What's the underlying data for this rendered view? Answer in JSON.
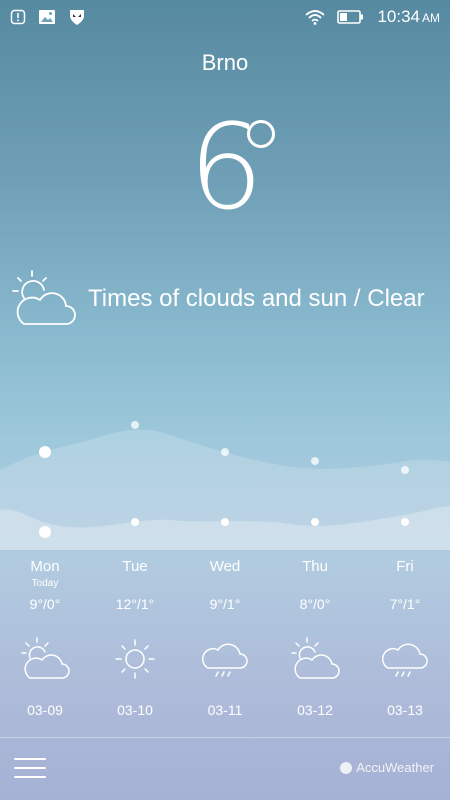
{
  "status_bar": {
    "time": "10:34",
    "ampm": "AM",
    "icons": [
      "alert-icon",
      "image-icon",
      "shield-icon",
      "wifi-icon",
      "battery-icon"
    ]
  },
  "current": {
    "city": "Brno",
    "temperature": "6",
    "condition": "Times of clouds and sun / Clear",
    "icon": "partly-cloudy-icon"
  },
  "chart_data": {
    "type": "line",
    "categories": [
      "Mon",
      "Tue",
      "Wed",
      "Thu",
      "Fri"
    ],
    "series": [
      {
        "values": [
          9,
          12,
          9,
          8,
          7
        ]
      },
      {
        "values": [
          0,
          1,
          1,
          1,
          1
        ]
      }
    ]
  },
  "forecast": [
    {
      "day": "Mon",
      "sub": "Today",
      "range": "9°/0°",
      "icon": "partly-cloudy-icon",
      "date": "03-09"
    },
    {
      "day": "Tue",
      "sub": "",
      "range": "12°/1°",
      "icon": "sun-icon",
      "date": "03-10"
    },
    {
      "day": "Wed",
      "sub": "",
      "range": "9°/1°",
      "icon": "rain-cloud-icon",
      "date": "03-11"
    },
    {
      "day": "Thu",
      "sub": "",
      "range": "8°/0°",
      "icon": "partly-cloudy-icon",
      "date": "03-12"
    },
    {
      "day": "Fri",
      "sub": "",
      "range": "7°/1°",
      "icon": "rain-cloud-icon",
      "date": "03-13"
    }
  ],
  "footer": {
    "brand": "AccuWeather"
  },
  "colors": {
    "top": "#568aa0",
    "middle": "#86b7cc",
    "bottom": "#a5b1d5"
  }
}
